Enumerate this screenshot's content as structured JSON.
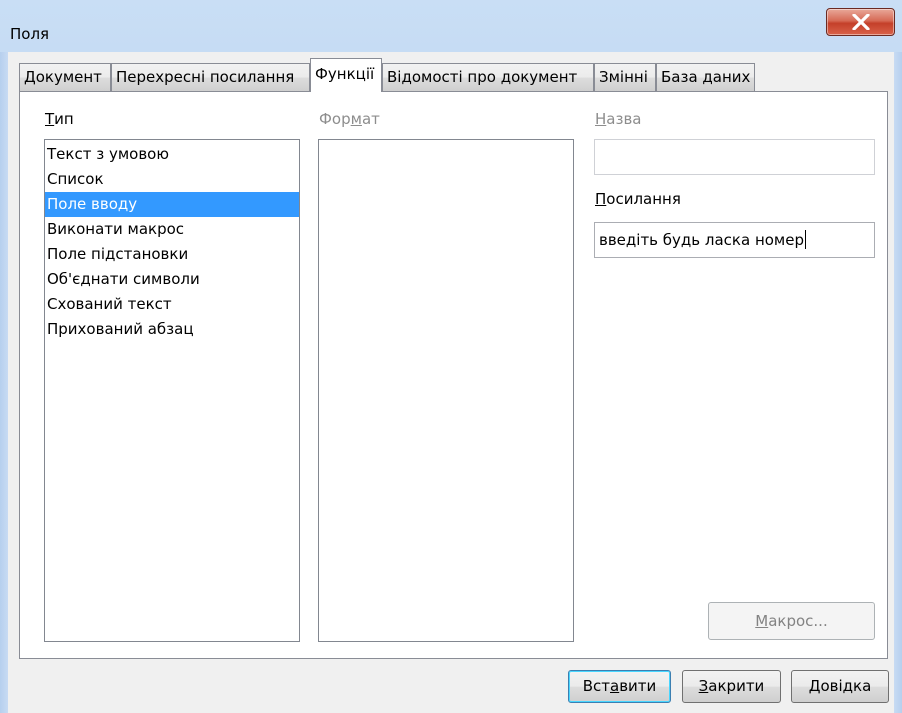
{
  "window": {
    "title": "Поля"
  },
  "tabs": [
    {
      "label": "Документ",
      "active": false
    },
    {
      "label": "Перехресні посилання",
      "active": false
    },
    {
      "label": "Функції",
      "active": true
    },
    {
      "label": "Відомості про документ",
      "active": false
    },
    {
      "label": "Змінні",
      "active": false
    },
    {
      "label": "База даних",
      "active": false
    }
  ],
  "type_section": {
    "label_u": "Т",
    "label_rest": "ип",
    "items": [
      "Текст з умовою",
      "Список",
      "Поле вводу",
      "Виконати макрос",
      "Поле підстановки",
      "Об'єднати символи",
      "Схований текст",
      "Прихований абзац"
    ],
    "selected": "Поле вводу"
  },
  "format_section": {
    "label_pre": "Фор",
    "label_u": "м",
    "label_post": "ат"
  },
  "name_section": {
    "label_u": "Н",
    "label_rest": "азва",
    "value": ""
  },
  "reference_section": {
    "label_u": "П",
    "label_rest": "осилання",
    "value": "введіть будь ласка номер"
  },
  "macro_button": {
    "label_u": "М",
    "label_rest": "акрос..."
  },
  "footer": {
    "insert_pre": "Вст",
    "insert_u": "а",
    "insert_post": "вити",
    "close_u": "З",
    "close_rest": "акрити",
    "help_u": "Д",
    "help_rest": "овідка"
  },
  "colors": {
    "selection": "#3399ff",
    "close_button": "#c4402a"
  }
}
